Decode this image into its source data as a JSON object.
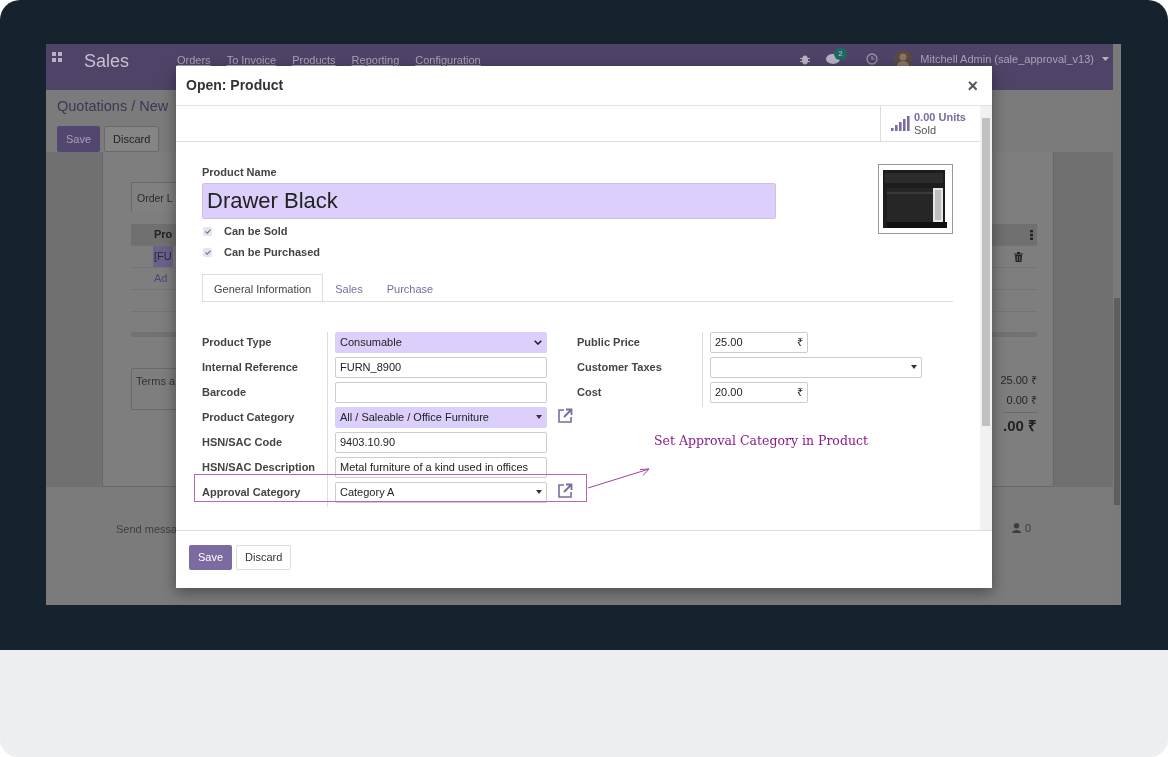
{
  "navbar": {
    "title": "Sales",
    "menu": [
      "Orders",
      "To Invoice",
      "Products",
      "Reporting",
      "Configuration"
    ],
    "chat_count": "2",
    "user": "Mitchell Admin (sale_approval_v13)"
  },
  "control_panel": {
    "breadcrumb": "Quotations / New",
    "buttons": [
      "Save",
      "Discard"
    ]
  },
  "sheet": {
    "tab": "Order L",
    "column": "Pro",
    "product_line": "[FU",
    "add_line": "Ad",
    "terms": "Terms a",
    "totals": [
      "25.00 ₹",
      "0.00 ₹",
      ".00 ₹"
    ]
  },
  "chatter": {
    "send_message": "Send messa",
    "followers": "0"
  },
  "dialog": {
    "title": "Open: Product",
    "close": "×",
    "stat": {
      "value": "0.00 Units",
      "label": "Sold"
    },
    "name_label": "Product Name",
    "name": "Drawer Black",
    "checks": [
      {
        "label": "Can be Sold",
        "checked": true
      },
      {
        "label": "Can be Purchased",
        "checked": true
      }
    ],
    "tabs": [
      {
        "label": "General Information",
        "selected": true
      },
      {
        "label": "Sales",
        "selected": false
      },
      {
        "label": "Purchase",
        "selected": false
      }
    ],
    "left_fields": [
      {
        "label": "Product Type",
        "kind": "select",
        "value": "Consumable",
        "required": true,
        "link": false
      },
      {
        "label": "Internal Reference",
        "kind": "text",
        "value": "FURN_8900",
        "required": false,
        "link": false
      },
      {
        "label": "Barcode",
        "kind": "text",
        "required": false,
        "link": false
      },
      {
        "label": "Product Category",
        "kind": "many2one",
        "value": "All / Saleable / Office Furniture",
        "required": true,
        "link": true
      },
      {
        "label": "HSN/SAC Code",
        "kind": "text",
        "value": "9403.10.90",
        "required": false,
        "link": false
      },
      {
        "label": "HSN/SAC Description",
        "kind": "text",
        "value": "Metal furniture of a kind used in offices",
        "required": false,
        "link": false
      },
      {
        "label": "Approval Category",
        "kind": "many2one",
        "value": "Category A",
        "required": false,
        "link": true
      }
    ],
    "right_fields": [
      {
        "label": "Public Price",
        "kind": "monetary",
        "value": "25.00",
        "currency": "₹"
      },
      {
        "label": "Customer Taxes",
        "kind": "many2one"
      },
      {
        "label": "Cost",
        "kind": "monetary",
        "value": "20.00",
        "currency": "₹"
      }
    ],
    "buttons": [
      "Save",
      "Discard"
    ]
  },
  "annotation": {
    "text": "Set Approval Category in Product"
  }
}
